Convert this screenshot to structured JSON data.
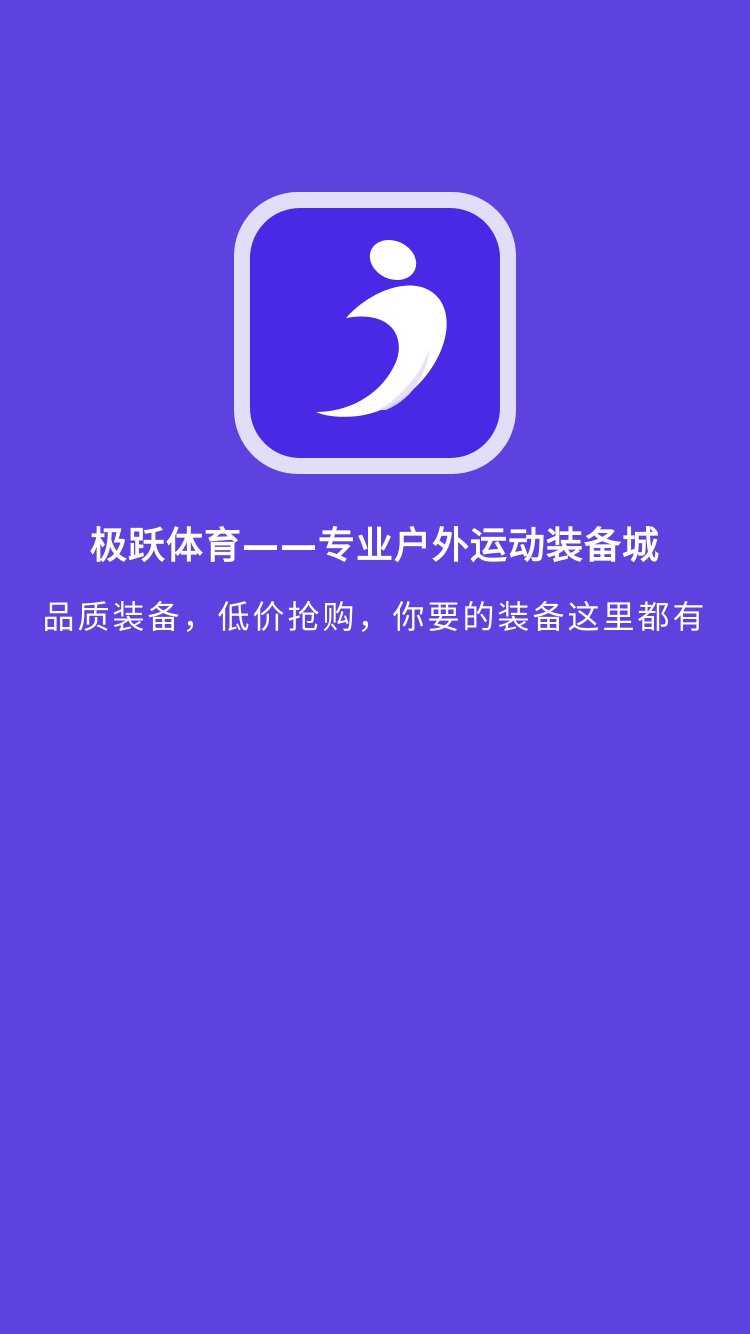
{
  "colors": {
    "background": "#5E42DF",
    "icon_frame": "#E3DEF7",
    "icon_fill": "#4A29E6",
    "logo_mark": "#FFFFFF",
    "text": "#FFFFFF"
  },
  "app_icon": {
    "icon": "jiyue-logo-icon"
  },
  "title": "极跃体育——专业户外运动装备城",
  "subtitle": "品质装备，低价抢购，你要的装备这里都有"
}
